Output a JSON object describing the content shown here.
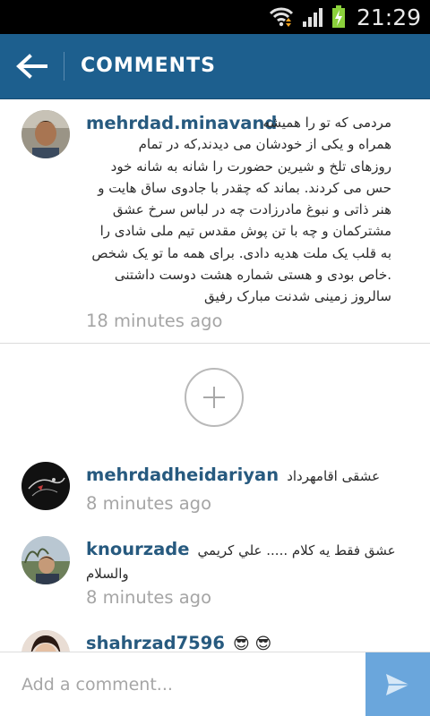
{
  "status_bar": {
    "time": "21:29"
  },
  "app_bar": {
    "title": "COMMENTS"
  },
  "comments": [
    {
      "username": "mehrdad.minavand",
      "lines": [
        "مردمی که تو را همیشه",
        "همراه و یکی از خودشان می دیدند,که در تمام",
        "روزهای تلخ و شیرین حضورت را شانه به شانه خود",
        "حس می کردند. بماند که چقدر با جادوی ساق هایت و",
        "هنر ذاتی و نبوغ مادرزادت چه در لباس سرخ عشق",
        "مشترکمان و چه با تن پوش مقدس تیم ملی شادی را",
        "به قلب یک ملت هدیه دادی. برای همه ما تو یک شخص",
        ".خاص بودی و هستی شماره هشت دوست داشتنی",
        "سالروز زمینی شدنت مبارک رفیق"
      ],
      "time": "18 minutes ago"
    },
    {
      "username": "mehrdadheidariyan",
      "text": "عشقی اقامهرداد",
      "time": "8 minutes ago"
    },
    {
      "username": "knourzade",
      "text": "عشق فقط یه کلام ..... علي كريمي",
      "text_line2": "والسلام",
      "time": "8 minutes ago"
    },
    {
      "username": "shahrzad7596",
      "text": "😎 😎"
    }
  ],
  "input": {
    "placeholder": "Add a comment..."
  },
  "colors": {
    "app_bar": "#1d5f8e",
    "username": "#275a7f",
    "send_button": "#6aa6dc"
  }
}
